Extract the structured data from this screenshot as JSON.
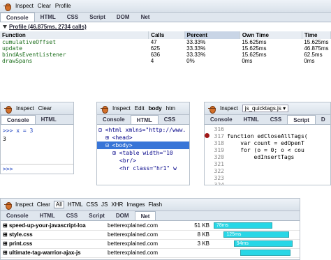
{
  "profile_panel": {
    "toolbar": [
      "Inspect",
      "Clear",
      "Profile"
    ],
    "tabs": [
      "Console",
      "HTML",
      "CSS",
      "Script",
      "DOM",
      "Net"
    ],
    "selected_tab": "Console",
    "profile_label": "Profile (46.875ms, 2734 calls)",
    "columns": [
      "Function",
      "Calls",
      "Percent",
      "Own Time",
      "Time"
    ],
    "rows": [
      [
        "cumulativeOffset",
        "47",
        "33.33%",
        "15.625ms",
        "15.625ms"
      ],
      [
        "update",
        "625",
        "33.33%",
        "15.625ms",
        "46.875ms"
      ],
      [
        "bindAsEventListener",
        "636",
        "33.33%",
        "15.625ms",
        "62.5ms"
      ],
      [
        "drawSpans",
        "4",
        "0%",
        "0ms",
        "0ms"
      ]
    ]
  },
  "console_panel": {
    "toolbar": [
      "Inspect",
      "Clear"
    ],
    "tabs": [
      "Console",
      "HTML"
    ],
    "lines": [
      ">>> x = 3",
      "3"
    ],
    "prompt": ">>>"
  },
  "html_panel": {
    "toolbar": [
      "Inspect",
      "Edit",
      "body",
      "htm"
    ],
    "tabs": [
      "Console",
      "HTML",
      "CSS"
    ],
    "lines": [
      "<html xmlns=\"http://www.",
      "<head>",
      "<body>",
      "<table width=\"10",
      "<br/>",
      "<hr class=\"hr1\" w"
    ]
  },
  "script_panel": {
    "toolbar": [
      "Inspect",
      "js_quicktags.js"
    ],
    "tabs": [
      "Console",
      "HTML",
      "CSS",
      "Script",
      "D"
    ],
    "line_numbers": [
      "316",
      "317",
      "318",
      "319",
      "320",
      "321",
      "322",
      "323",
      "324"
    ],
    "code": [
      "",
      "function edCloseAllTags(",
      "    var count = edOpenT",
      "    for (o = 0; o < cou",
      "        edInsertTags",
      "",
      "",
      "",
      ""
    ],
    "breakpoint_line": "317"
  },
  "net_panel": {
    "toolbar": [
      "Inspect",
      "Clear",
      "All",
      "HTML",
      "CSS",
      "JS",
      "XHR",
      "Images",
      "Flash"
    ],
    "tabs": [
      "Console",
      "HTML",
      "CSS",
      "Script",
      "DOM",
      "Net"
    ],
    "rows": [
      {
        "file": "speed-up-your-javascript-loa",
        "domain": "betterexplained.com",
        "size": "51 KB",
        "time": "78ms",
        "pct": 0.3,
        "offset": 0.0
      },
      {
        "file": "style.css",
        "domain": "betterexplained.com",
        "size": "8 KB",
        "time": "125ms",
        "pct": 0.38,
        "offset": 0.12
      },
      {
        "file": "print.css",
        "domain": "betterexplained.com",
        "size": "3 KB",
        "time": "94ms",
        "pct": 0.3,
        "offset": 0.24
      },
      {
        "file": "ultimate-tag-warrior-ajax-js",
        "domain": "betterexplained.com",
        "size": "",
        "time": "",
        "pct": 0.2,
        "offset": 0.32
      }
    ]
  }
}
